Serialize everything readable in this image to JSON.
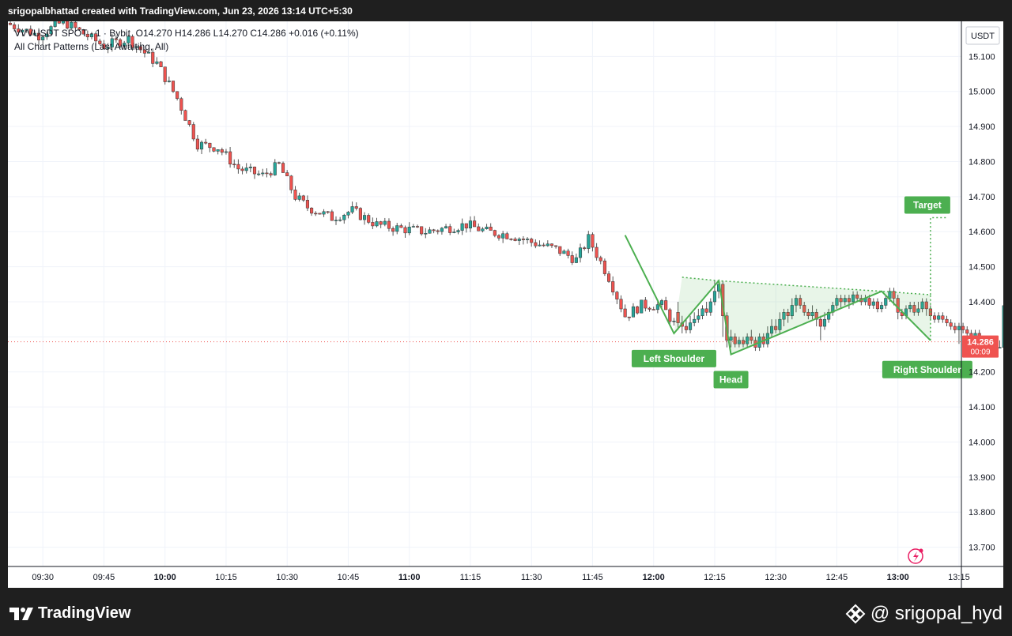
{
  "header": {
    "text": "srigopalbhattad created with TradingView.com, Jun 23, 2026 13:14 UTC+5:30"
  },
  "legend": {
    "symbol": "VVVUSDT SPOT · 1 · Bybit",
    "ohlc": "O14.270  H14.286  L14.270  C14.286  +0.016 (+0.11%)",
    "indicator": "All Chart Patterns (Last Awaiting, All)"
  },
  "footer": {
    "brand": "TradingView",
    "handle": "@ srigopal_hyd"
  },
  "chart_data": {
    "type": "candlestick",
    "currency": "USDT",
    "y_ticks": [
      15.1,
      15.0,
      14.9,
      14.8,
      14.7,
      14.6,
      14.5,
      14.4,
      14.3,
      14.2,
      14.1,
      14.0,
      13.9,
      13.8,
      13.7
    ],
    "ylim": [
      13.645,
      15.2
    ],
    "x_ticks": [
      "09:30",
      "09:45",
      "10:00",
      "10:15",
      "10:30",
      "10:45",
      "11:00",
      "11:15",
      "11:30",
      "11:45",
      "12:00",
      "12:15",
      "12:30",
      "12:45",
      "13:00",
      "13:15"
    ],
    "bold_ticks": [
      "10:00",
      "11:00",
      "12:00",
      "13:00"
    ],
    "x_start": "09:22",
    "last_price": {
      "value": "14.286",
      "countdown": "00:09",
      "color": "#ef5350"
    },
    "colors": {
      "up": "#26a69a",
      "down": "#ef5350",
      "pattern": "#4caf50"
    },
    "waypoints": [
      [
        0,
        15.195
      ],
      [
        8,
        15.16
      ],
      [
        14,
        15.2
      ],
      [
        24,
        15.13
      ],
      [
        30,
        15.15
      ],
      [
        37,
        15.08
      ],
      [
        42,
        14.98
      ],
      [
        47,
        14.85
      ],
      [
        52,
        14.84
      ],
      [
        57,
        14.78
      ],
      [
        63,
        14.76
      ],
      [
        67,
        14.79
      ],
      [
        71,
        14.7
      ],
      [
        74,
        14.67
      ],
      [
        80,
        14.64
      ],
      [
        85,
        14.66
      ],
      [
        91,
        14.62
      ],
      [
        96,
        14.61
      ],
      [
        103,
        14.6
      ],
      [
        108,
        14.61
      ],
      [
        113,
        14.62
      ],
      [
        118,
        14.6
      ],
      [
        124,
        14.59
      ],
      [
        129,
        14.57
      ],
      [
        135,
        14.55
      ],
      [
        140,
        14.52
      ],
      [
        143,
        14.58
      ],
      [
        148,
        14.47
      ],
      [
        152,
        14.36
      ],
      [
        156,
        14.39
      ],
      [
        161,
        14.39
      ],
      [
        165,
        14.32
      ],
      [
        170,
        14.39
      ],
      [
        174,
        14.44
      ],
      [
        177,
        14.42
      ],
      [
        180,
        14.3
      ],
      [
        183,
        14.27
      ],
      [
        186,
        14.28
      ],
      [
        191,
        14.31
      ],
      [
        196,
        14.36
      ],
      [
        201,
        14.4
      ],
      [
        205,
        14.38
      ],
      [
        209,
        14.35
      ],
      [
        213,
        14.32
      ],
      [
        217,
        14.39
      ],
      [
        222,
        14.41
      ],
      [
        227,
        14.42
      ],
      [
        230,
        14.4
      ],
      [
        234,
        14.43
      ],
      [
        236,
        14.39
      ],
      [
        240,
        14.36
      ],
      [
        243,
        14.39
      ],
      [
        247,
        14.36
      ],
      [
        251,
        14.34
      ],
      [
        255,
        14.33
      ],
      [
        258,
        14.31
      ],
      [
        259,
        14.286
      ]
    ],
    "candles": [
      [
        164,
        14.37,
        14.34,
        14.4,
        14.32
      ],
      [
        165,
        14.34,
        14.33,
        14.36,
        14.31
      ],
      [
        166,
        14.33,
        14.32,
        14.35,
        14.31
      ],
      [
        167,
        14.32,
        14.34,
        14.36,
        14.31
      ],
      [
        168,
        14.34,
        14.35,
        14.37,
        14.33
      ],
      [
        169,
        14.35,
        14.36,
        14.38,
        14.34
      ],
      [
        170,
        14.36,
        14.38,
        14.39,
        14.35
      ],
      [
        171,
        14.38,
        14.37,
        14.4,
        14.36
      ],
      [
        172,
        14.37,
        14.4,
        14.41,
        14.36
      ],
      [
        173,
        14.4,
        14.43,
        14.46,
        14.39
      ],
      [
        174,
        14.43,
        14.45,
        14.46,
        14.41
      ],
      [
        175,
        14.45,
        14.36,
        14.46,
        14.3
      ],
      [
        176,
        14.36,
        14.29,
        14.37,
        14.27
      ],
      [
        177,
        14.29,
        14.3,
        14.32,
        14.27
      ],
      [
        178,
        14.3,
        14.28,
        14.31,
        14.27
      ],
      [
        179,
        14.28,
        14.29,
        14.3,
        14.27
      ],
      [
        180,
        14.29,
        14.28,
        14.3,
        14.27
      ],
      [
        181,
        14.28,
        14.3,
        14.31,
        14.27
      ],
      [
        182,
        14.3,
        14.29,
        14.32,
        14.28
      ],
      [
        183,
        14.29,
        14.27,
        14.3,
        14.26
      ],
      [
        184,
        14.27,
        14.3,
        14.31,
        14.26
      ],
      [
        185,
        14.3,
        14.28,
        14.31,
        14.27
      ],
      [
        186,
        14.28,
        14.31,
        14.33,
        14.27
      ],
      [
        187,
        14.31,
        14.33,
        14.35,
        14.3
      ],
      [
        188,
        14.33,
        14.32,
        14.35,
        14.31
      ],
      [
        189,
        14.32,
        14.35,
        14.37,
        14.31
      ],
      [
        190,
        14.35,
        14.37,
        14.38,
        14.33
      ],
      [
        191,
        14.37,
        14.36,
        14.38,
        14.34
      ],
      [
        192,
        14.36,
        14.39,
        14.41,
        14.35
      ],
      [
        193,
        14.39,
        14.41,
        14.42,
        14.37
      ],
      [
        194,
        14.41,
        14.39,
        14.42,
        14.38
      ],
      [
        195,
        14.39,
        14.37,
        14.4,
        14.36
      ],
      [
        196,
        14.37,
        14.36,
        14.38,
        14.35
      ],
      [
        197,
        14.36,
        14.37,
        14.39,
        14.35
      ],
      [
        198,
        14.37,
        14.35,
        14.38,
        14.33
      ],
      [
        199,
        14.35,
        14.33,
        14.36,
        14.29
      ],
      [
        200,
        14.33,
        14.35,
        14.37,
        14.32
      ],
      [
        201,
        14.35,
        14.37,
        14.38,
        14.34
      ],
      [
        202,
        14.37,
        14.39,
        14.4,
        14.36
      ],
      [
        203,
        14.39,
        14.41,
        14.42,
        14.38
      ],
      [
        204,
        14.41,
        14.4,
        14.42,
        14.38
      ],
      [
        205,
        14.4,
        14.41,
        14.42,
        14.39
      ],
      [
        206,
        14.41,
        14.4,
        14.42,
        14.38
      ],
      [
        207,
        14.4,
        14.42,
        14.43,
        14.39
      ],
      [
        208,
        14.42,
        14.41,
        14.43,
        14.4
      ],
      [
        209,
        14.41,
        14.4,
        14.42,
        14.39
      ],
      [
        210,
        14.4,
        14.41,
        14.42,
        14.39
      ],
      [
        211,
        14.41,
        14.39,
        14.42,
        14.38
      ],
      [
        212,
        14.39,
        14.4,
        14.41,
        14.38
      ],
      [
        213,
        14.4,
        14.38,
        14.41,
        14.37
      ],
      [
        214,
        14.38,
        14.39,
        14.4,
        14.37
      ],
      [
        215,
        14.39,
        14.41,
        14.42,
        14.38
      ],
      [
        216,
        14.41,
        14.43,
        14.44,
        14.4
      ],
      [
        217,
        14.43,
        14.41,
        14.44,
        14.39
      ],
      [
        218,
        14.41,
        14.37,
        14.42,
        14.35
      ],
      [
        219,
        14.37,
        14.36,
        14.38,
        14.35
      ],
      [
        220,
        14.36,
        14.38,
        14.39,
        14.35
      ],
      [
        221,
        14.38,
        14.39,
        14.4,
        14.37
      ],
      [
        222,
        14.39,
        14.37,
        14.4,
        14.36
      ],
      [
        223,
        14.37,
        14.38,
        14.4,
        14.36
      ],
      [
        224,
        14.38,
        14.4,
        14.41,
        14.37
      ],
      [
        225,
        14.4,
        14.38,
        14.41,
        14.36
      ],
      [
        226,
        14.38,
        14.36,
        14.39,
        14.35
      ],
      [
        227,
        14.36,
        14.35,
        14.37,
        14.34
      ],
      [
        228,
        14.35,
        14.36,
        14.37,
        14.34
      ],
      [
        229,
        14.36,
        14.35,
        14.37,
        14.34
      ],
      [
        230,
        14.35,
        14.34,
        14.36,
        14.33
      ],
      [
        231,
        14.34,
        14.33,
        14.35,
        14.32
      ],
      [
        232,
        14.33,
        14.32,
        14.34,
        14.31
      ],
      [
        233,
        14.32,
        14.33,
        14.34,
        14.28
      ],
      [
        234,
        14.33,
        14.32,
        14.34,
        14.31
      ],
      [
        235,
        14.32,
        14.31,
        14.33,
        14.3
      ],
      [
        236,
        14.31,
        14.3,
        14.32,
        14.29
      ],
      [
        237,
        14.3,
        14.31,
        14.32,
        14.29
      ],
      [
        238,
        14.31,
        14.28,
        14.32,
        14.27
      ],
      [
        239,
        14.28,
        14.27,
        14.29,
        14.27
      ],
      [
        240,
        14.27,
        14.29,
        14.3,
        14.27
      ],
      [
        241,
        14.29,
        14.28,
        14.3,
        14.27
      ],
      [
        242,
        14.28,
        14.27,
        14.29,
        14.27
      ],
      [
        243,
        14.27,
        14.27,
        14.29,
        14.27
      ]
    ],
    "pattern": {
      "name": "Inverse Head and Shoulders",
      "zigzag": [
        [
          151,
          14.59
        ],
        [
          163,
          14.31
        ],
        [
          174,
          14.46
        ],
        [
          177,
          14.25
        ],
        [
          214,
          14.43
        ],
        [
          226,
          14.29
        ]
      ],
      "neckline": [
        [
          165,
          14.47
        ],
        [
          174,
          14.46
        ],
        [
          214,
          14.43
        ],
        [
          226,
          14.42
        ]
      ],
      "target_line": [
        [
          226,
          14.42
        ],
        [
          226,
          14.64
        ],
        [
          230,
          14.64
        ]
      ],
      "labels": {
        "left_shoulder": "Left Shoulder",
        "head": "Head",
        "right_shoulder": "Right Shoulder",
        "target": "Target"
      }
    }
  }
}
